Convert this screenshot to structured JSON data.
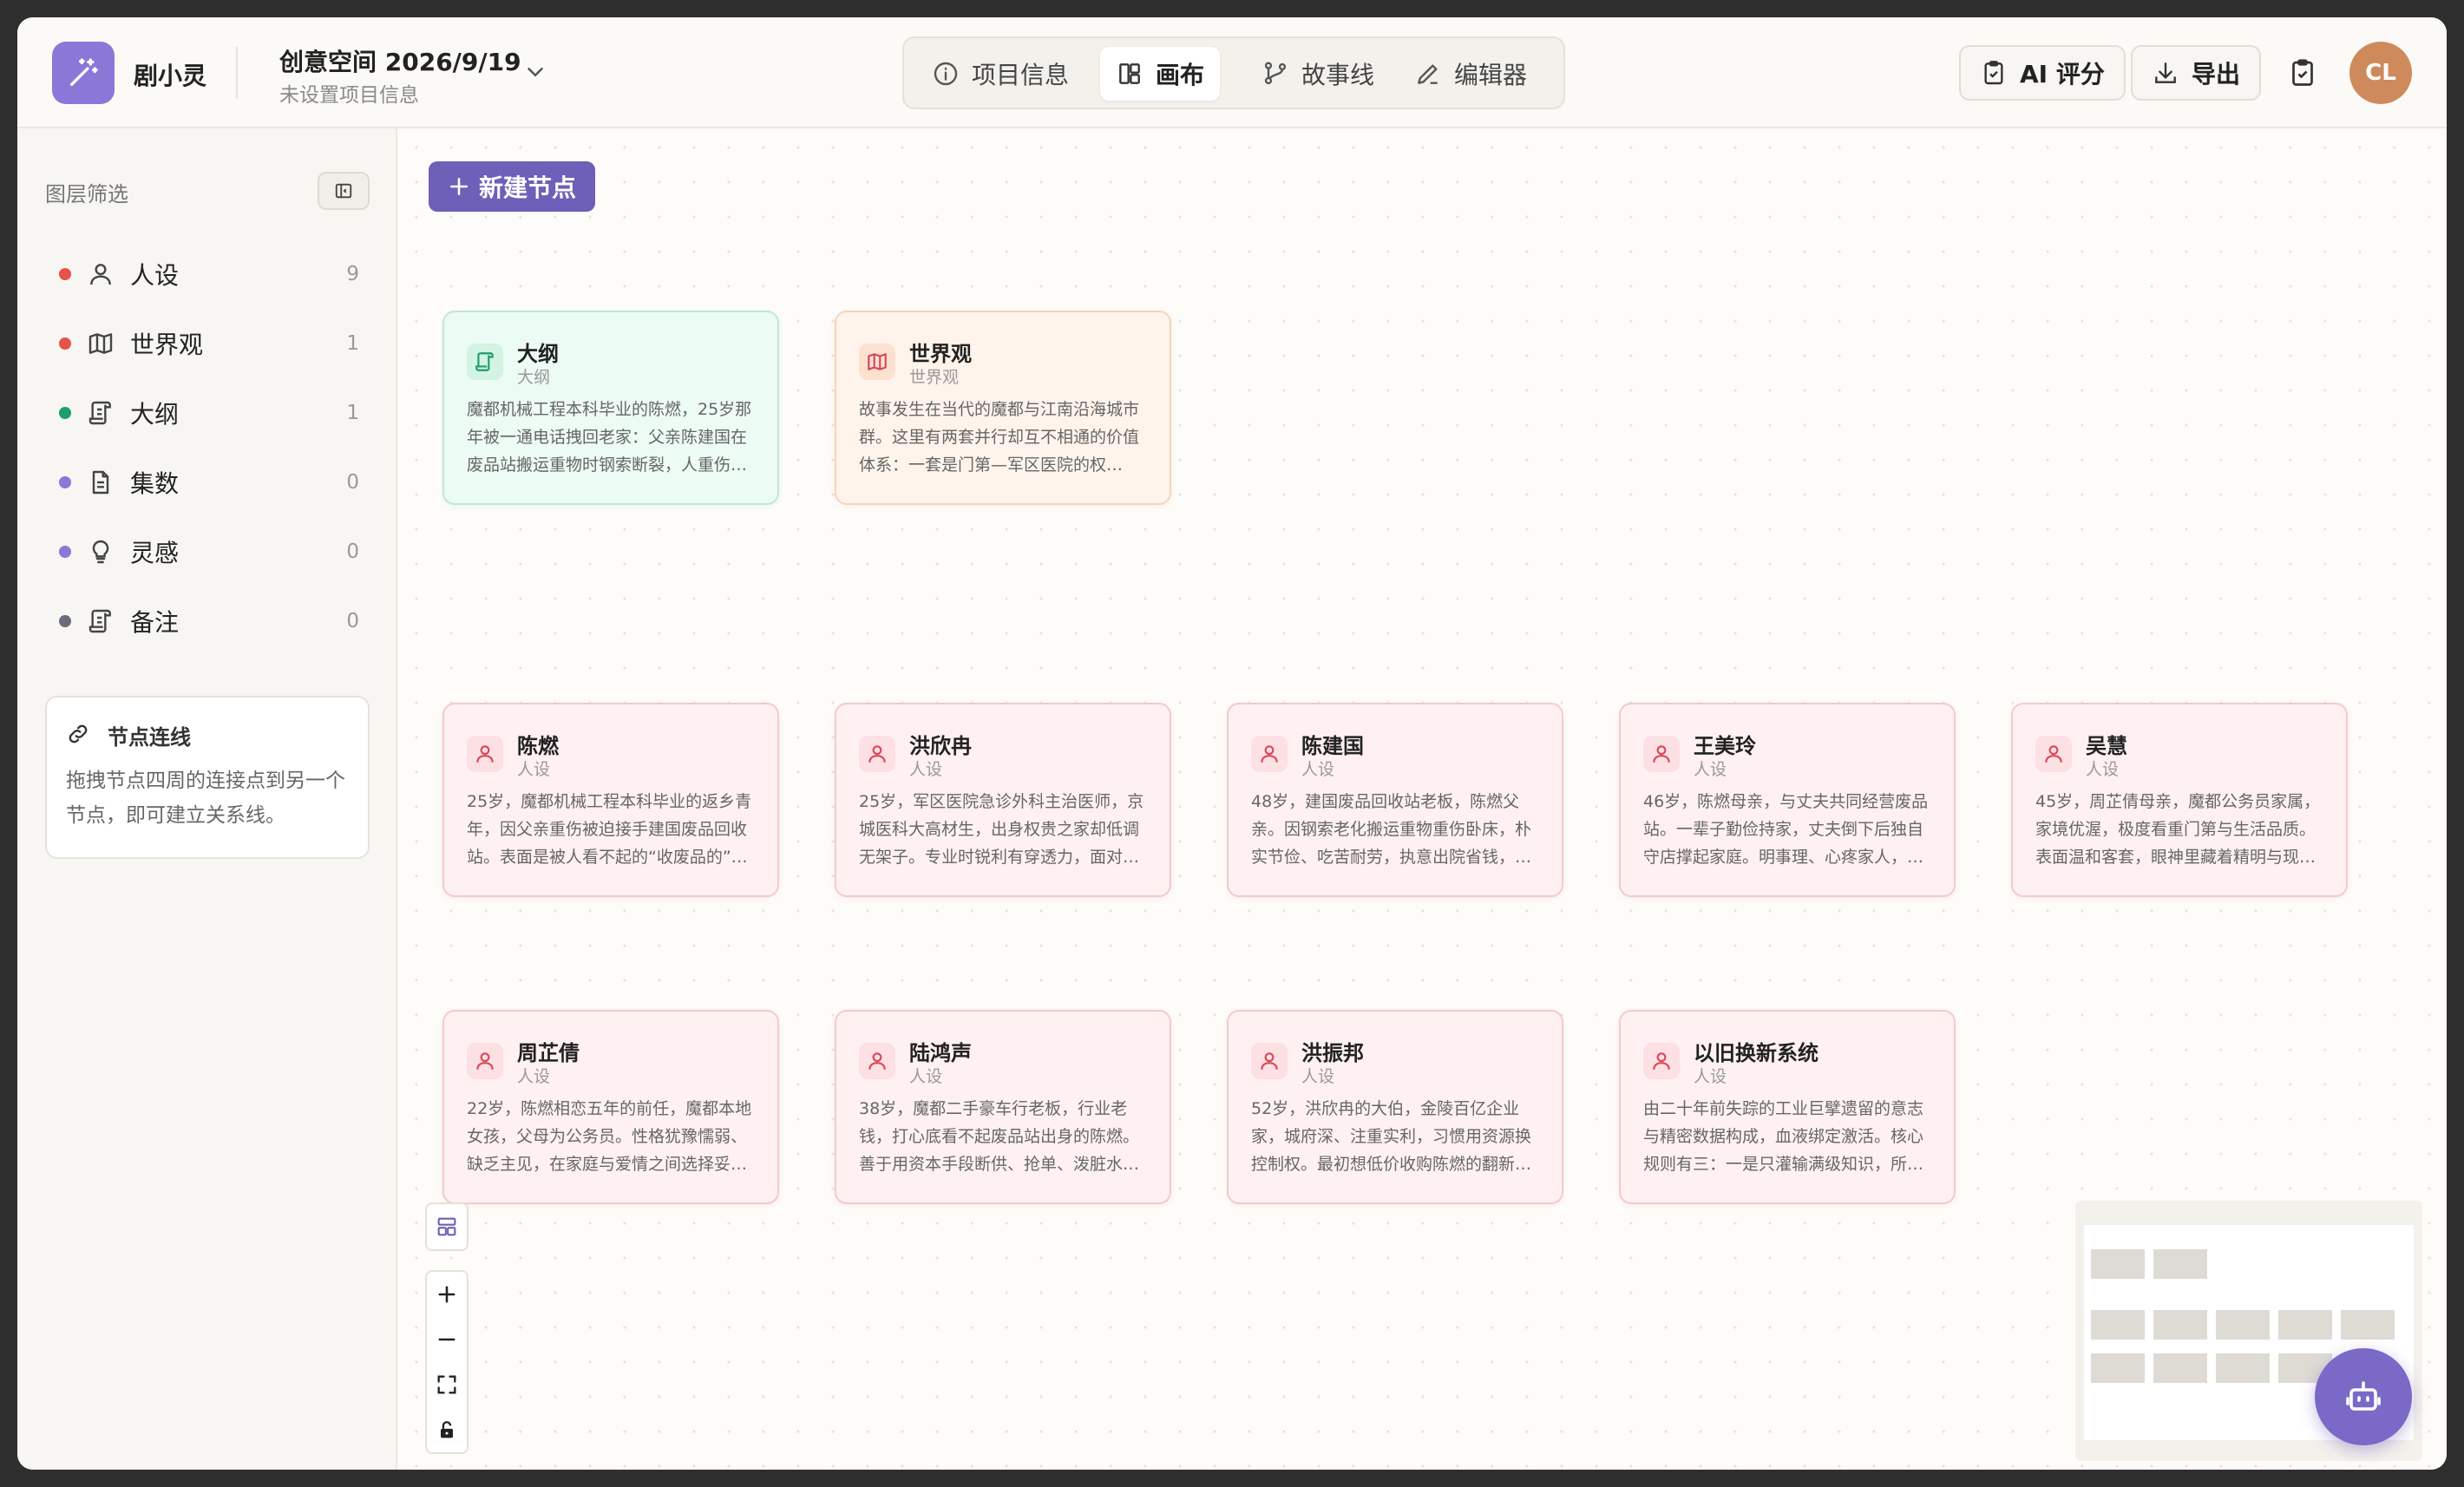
{
  "header": {
    "app_name": "剧小灵",
    "project_title": "创意空间 2026/9/19",
    "project_subtitle": "未设置项目信息",
    "tabs": [
      {
        "label": "项目信息",
        "icon": "info-icon",
        "active": false
      },
      {
        "label": "画布",
        "icon": "layout-icon",
        "active": true
      },
      {
        "label": "故事线",
        "icon": "branch-icon",
        "active": false
      },
      {
        "label": "编辑器",
        "icon": "pen-icon",
        "active": false
      }
    ],
    "ai_score_label": "AI 评分",
    "export_label": "导出",
    "avatar_initials": "CL"
  },
  "sidebar": {
    "title": "图层筛选",
    "layers": [
      {
        "label": "人设",
        "count": "9",
        "color": "#e5534b",
        "icon": "user-icon"
      },
      {
        "label": "世界观",
        "count": "1",
        "color": "#e5534b",
        "icon": "map-icon"
      },
      {
        "label": "大纲",
        "count": "1",
        "color": "#1f9d6b",
        "icon": "scroll-icon"
      },
      {
        "label": "集数",
        "count": "0",
        "color": "#8a78d9",
        "icon": "document-icon"
      },
      {
        "label": "灵感",
        "count": "0",
        "color": "#8a78d9",
        "icon": "lightbulb-icon"
      },
      {
        "label": "备注",
        "count": "0",
        "color": "#6b6b7b",
        "icon": "scroll-icon"
      }
    ],
    "connection_card": {
      "title": "节点连线",
      "description": "拖拽节点四周的连接点到另一个节点，即可建立关系线。"
    }
  },
  "canvas": {
    "new_node_label": "新建节点",
    "nodes": [
      {
        "title": "大纲",
        "type": "大纲",
        "kind": "outline",
        "desc": "魔都机械工程本科毕业的陈燃，25岁那年被一通电话拽回老家：父亲陈建国在废品站搬运重物时钢索断裂，人重伤…"
      },
      {
        "title": "世界观",
        "type": "世界观",
        "kind": "world",
        "desc": "故事发生在当代的魔都与江南沿海城市群。这里有两套并行却互不相通的价值体系：一套是门第—军区医院的权…"
      },
      {
        "title": "陈燃",
        "type": "人设",
        "kind": "role",
        "desc": "25岁，魔都机械工程本科毕业的返乡青年，因父亲重伤被迫接手建国废品回收站。表面是被人看不起的“收废品的”…"
      },
      {
        "title": "洪欣冉",
        "type": "人设",
        "kind": "role",
        "desc": "25岁，军区医院急诊外科主治医师，京城医科大高材生，出身权贵之家却低调无架子。专业时锐利有穿透力，面对…"
      },
      {
        "title": "陈建国",
        "type": "人设",
        "kind": "role",
        "desc": "48岁，建国废品回收站老板，陈燃父亲。因钢索老化搬运重物重伤卧床，朴实节俭、吃苦耐劳，执意出院省钱，…"
      },
      {
        "title": "王美玲",
        "type": "人设",
        "kind": "role",
        "desc": "46岁，陈燃母亲，与丈夫共同经营废品站。一辈子勤俭持家，丈夫倒下后独自守店撑起家庭。明事理、心疼家人，…"
      },
      {
        "title": "吴慧",
        "type": "人设",
        "kind": "role",
        "desc": "45岁，周芷倩母亲，魔都公务员家属，家境优渥，极度看重门第与生活品质。表面温和客套，眼神里藏着精明与现…"
      },
      {
        "title": "周芷倩",
        "type": "人设",
        "kind": "role",
        "desc": "22岁，陈燃相恋五年的前任，魔都本地女孩，父母为公务员。性格犹豫懦弱、缺乏主见，在家庭与爱情之间选择妥…"
      },
      {
        "title": "陆鸿声",
        "type": "人设",
        "kind": "role",
        "desc": "38岁，魔都二手豪车行老板，行业老钱，打心底看不起废品站出身的陈燃。善于用资本手段断供、抢单、泼脏水…"
      },
      {
        "title": "洪振邦",
        "type": "人设",
        "kind": "role",
        "desc": "52岁，洪欣冉的大伯，金陵百亿企业家，城府深、注重实利，习惯用资源换控制权。最初想低价收购陈燃的翻新…"
      },
      {
        "title": "以旧换新系统",
        "type": "人设",
        "kind": "role",
        "desc": "由二十年前失踪的工业巨擘遗留的意志与精密数据构成，血液绑定激活。核心规则有三：一是只灌输满级知识，所…"
      }
    ]
  },
  "colors": {
    "accent": "#6e5fb8",
    "logo": "#8a78d9",
    "avatar": "#cf8a5c",
    "role_icon": "#d9485a",
    "outline_icon": "#1f9d6b",
    "world_icon": "#d9485a"
  }
}
